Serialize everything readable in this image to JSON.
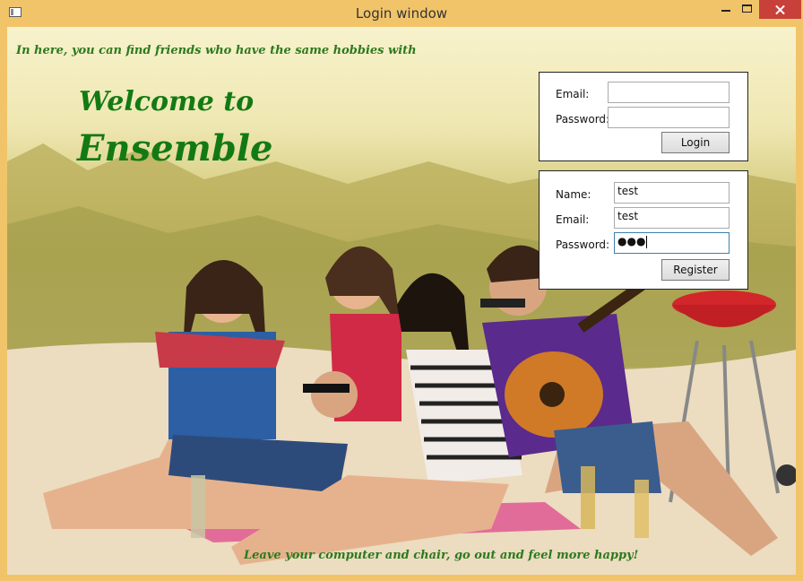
{
  "window": {
    "title": "Login window"
  },
  "content": {
    "tagline": "In here, you can find friends who have the same hobbies with",
    "welcome": "Welcome to",
    "brand": "Ensemble",
    "footer": "Leave your computer and chair, go out and feel more happy!"
  },
  "login": {
    "email_label": "Email:",
    "email_value": "",
    "password_label": "Password:",
    "password_value": "",
    "button": "Login"
  },
  "register": {
    "name_label": "Name:",
    "name_value": "test",
    "email_label": "Email:",
    "email_value": "test",
    "password_label": "Password:",
    "password_mask": "●●●",
    "button": "Register"
  },
  "colors": {
    "title_bar": "#f1c46a",
    "close_button": "#c7403a",
    "heading_green": "#137a13",
    "tagline_green": "#2c7a1e"
  },
  "icons": {
    "app": "app-window-icon",
    "minimize": "minimize-icon",
    "maximize": "maximize-icon",
    "close": "close-icon"
  }
}
